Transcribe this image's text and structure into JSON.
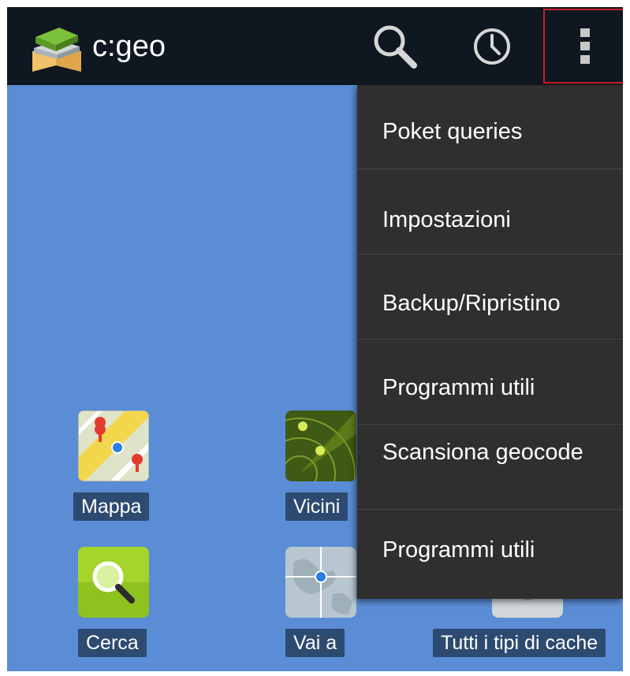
{
  "actionbar": {
    "app_name": "c:geo",
    "logo_icon": "cgeo-logo-icon",
    "search_icon": "search-icon",
    "history_icon": "clock-icon",
    "overflow_icon": "overflow-menu-icon"
  },
  "home": {
    "buttons": [
      {
        "label": "Mappa",
        "icon": "map-icon"
      },
      {
        "label": "Vicini",
        "icon": "radar-icon"
      },
      {
        "label": "Cerca",
        "icon": "search-icon"
      },
      {
        "label": "Vai a",
        "icon": "globe-navigate-icon"
      },
      {
        "label": "Tutti i tipi di cache",
        "icon": "cache-icon"
      }
    ]
  },
  "overflow_menu": {
    "items": [
      {
        "label": "Poket queries"
      },
      {
        "label": "Impostazioni"
      },
      {
        "label": "Backup/Ripristino"
      },
      {
        "label": "Programmi utili"
      },
      {
        "label": "Scansiona geocode"
      },
      {
        "label": "Programmi utili"
      }
    ]
  },
  "colors": {
    "actionbar_bg": "#0f1720",
    "home_bg": "#5a8dd6",
    "menu_bg": "#2f2f2f",
    "highlight_border": "#c8202c",
    "label_bg": "#2d4a70"
  }
}
